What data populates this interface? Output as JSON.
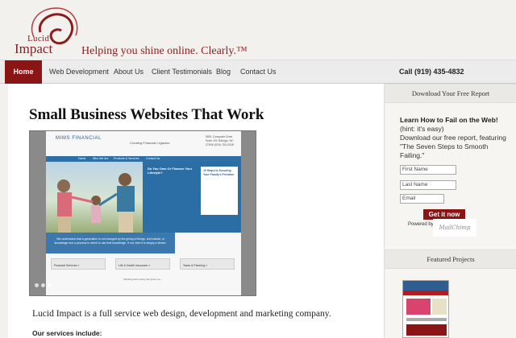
{
  "header": {
    "logo_line1": "Lucid",
    "logo_line2": "Impact",
    "tagline": "Helping you shine online. Clearly.™"
  },
  "nav": {
    "items": [
      "Home",
      "Web Development",
      "About Us",
      "Client Testimonials",
      "Blog",
      "Contact Us"
    ],
    "phone": "Call (919) 435-4832"
  },
  "main": {
    "title": "Small Business Websites That Work",
    "intro": "Lucid Impact is a full service web design, development and marketing company.",
    "services_heading": "Our services include:",
    "screenshot": {
      "logo": "MIMS FINANCIAL",
      "tagline": "Creating Financial Legacies",
      "address": "5801 Computer Drive Suite 101 Raleigh, NC 27606 (919) 754-0038",
      "nav": [
        "Home",
        "Who We Are",
        "Products & Services",
        "Contact Us"
      ],
      "headline": "Do You Own Or Finance Your Lifestyle?",
      "side_title": "10 Steps to Securing Your Family's Freedom",
      "quote": "We understand that a generation is not changed by the giving of things, but instead, of knowledge and a process in which to use that knowledge. If not, then it is simply a dream.",
      "boxes": [
        "Financial Services »",
        "Life & Health Insurance »",
        "Taxes & Planning »"
      ],
      "footer": "\"Working with Lesley has given me..."
    }
  },
  "sidebar": {
    "report_heading": "Download Your Free Report",
    "learn": "Learn How to Fail on the Web!",
    "hint": "(hint: it's easy)",
    "desc": "Download our free report, featuring \"The Seven Steps to Smooth Failing.\"",
    "first_name": "First Name",
    "last_name": "Last Name",
    "email": "Email",
    "button": "Get it now",
    "powered": "Powered by",
    "mailchimp": "MailChimp",
    "featured_heading": "Featured Projects"
  },
  "colors": {
    "brand_red": "#8b1414",
    "background": "#f3f1ee",
    "mims_blue": "#2e6fa6"
  }
}
